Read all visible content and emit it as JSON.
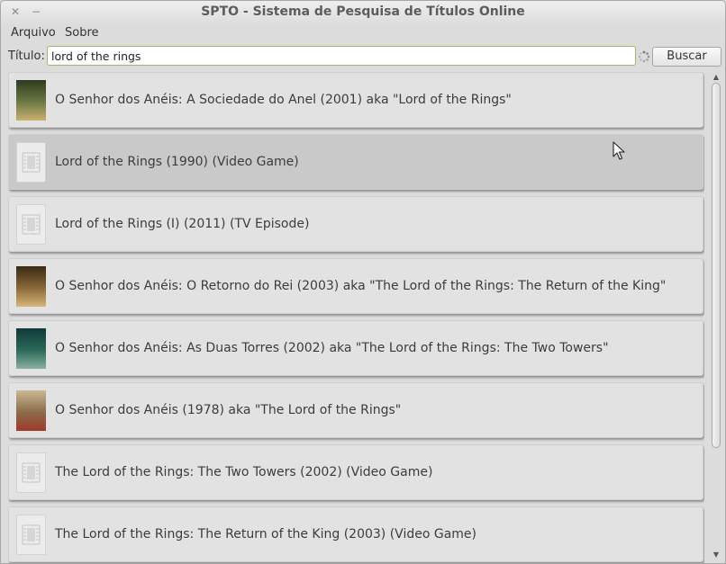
{
  "window": {
    "title": "SPTO - Sistema de Pesquisa de Títulos Online"
  },
  "menu": {
    "items": [
      "Arquivo",
      "Sobre"
    ]
  },
  "search": {
    "label": "Título:",
    "value": "lord of the rings",
    "button": "Buscar"
  },
  "results": [
    {
      "text": "O Senhor dos Anéis: A Sociedade do Anel (2001) aka \"Lord of the Rings\"",
      "thumb": "poster",
      "colors": [
        "#2d3a1f",
        "#6e7a45",
        "#c8b070"
      ]
    },
    {
      "text": "Lord of the Rings (1990) (Video Game)",
      "thumb": "placeholder",
      "selected": true
    },
    {
      "text": "Lord of the Rings (I) (2011) (TV Episode)",
      "thumb": "placeholder"
    },
    {
      "text": "O Senhor dos Anéis: O Retorno do Rei (2003) aka \"The Lord of the Rings: The Return of the King\"",
      "thumb": "poster",
      "colors": [
        "#3a2a14",
        "#8a6a3a",
        "#d8b77a"
      ]
    },
    {
      "text": "O Senhor dos Anéis: As Duas Torres (2002) aka \"The Lord of the Rings: The Two Towers\"",
      "thumb": "poster",
      "colors": [
        "#0f3a3a",
        "#2d6a5a",
        "#8ab0a0"
      ]
    },
    {
      "text": "O Senhor dos Anéis (1978) aka \"The Lord of the Rings\"",
      "thumb": "poster",
      "colors": [
        "#c8b890",
        "#8a6a4a",
        "#a03a2a"
      ]
    },
    {
      "text": "The Lord of the Rings: The Two Towers (2002) (Video Game)",
      "thumb": "placeholder"
    },
    {
      "text": "The Lord of the Rings: The Return of the King (2003) (Video Game)",
      "thumb": "placeholder"
    }
  ]
}
